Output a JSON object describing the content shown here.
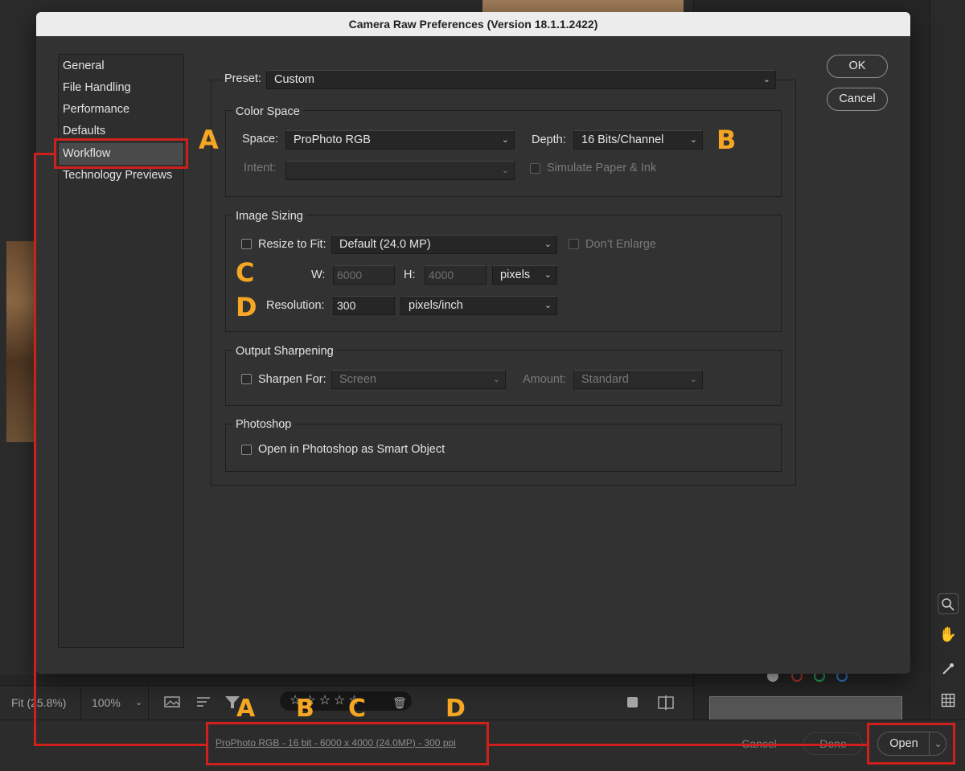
{
  "dialog": {
    "title": "Camera Raw Preferences  (Version 18.1.1.2422)",
    "ok_label": "OK",
    "cancel_label": "Cancel",
    "nav": [
      "General",
      "File Handling",
      "Performance",
      "Defaults",
      "Workflow",
      "Technology Previews"
    ],
    "selected_nav": "Workflow",
    "preset_label": "Preset:",
    "preset_value": "Custom",
    "color_space": {
      "title": "Color Space",
      "space_label": "Space:",
      "space_value": "ProPhoto RGB",
      "depth_label": "Depth:",
      "depth_value": "16 Bits/Channel",
      "intent_label": "Intent:",
      "intent_value": "",
      "simulate_label": "Simulate Paper & Ink"
    },
    "image_sizing": {
      "title": "Image Sizing",
      "resize_label": "Resize to Fit:",
      "resize_value": "Default  (24.0 MP)",
      "dont_enlarge_label": "Don’t Enlarge",
      "w_label": "W:",
      "w_value": "6000",
      "h_label": "H:",
      "h_value": "4000",
      "units_value": "pixels",
      "resolution_label": "Resolution:",
      "resolution_value": "300",
      "resolution_units": "pixels/inch"
    },
    "output_sharpening": {
      "title": "Output Sharpening",
      "sharpen_label": "Sharpen For:",
      "sharpen_value": "Screen",
      "amount_label": "Amount:",
      "amount_value": "Standard"
    },
    "photoshop": {
      "title": "Photoshop",
      "smart_object_label": "Open in Photoshop as Smart Object"
    }
  },
  "bottom_toolbar": {
    "fit_label": "Fit (25.8%)",
    "zoom_label": "100%",
    "stars": "☆☆☆☆☆"
  },
  "footer": {
    "workflow_link": "ProPhoto RGB - 16 bit - 6000 x 4000 (24.0MP) - 300 ppi",
    "cancel_label": "Cancel",
    "done_label": "Done",
    "open_label": "Open"
  },
  "annotations": {
    "a": "A",
    "b": "B",
    "c": "C",
    "d": "D"
  },
  "colors": {
    "annotation": "#f5a623",
    "highlight_box": "#d0201c"
  }
}
